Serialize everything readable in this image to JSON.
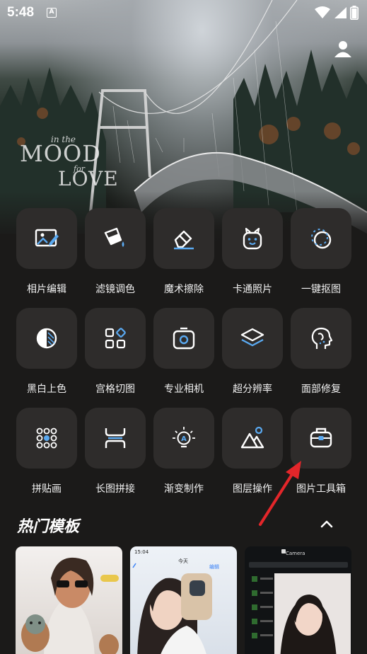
{
  "status_bar": {
    "time": "5:48",
    "notification_glyph": "A"
  },
  "hero": {
    "text_in_the": "in the",
    "text_mood": "MOOD",
    "text_for": "for",
    "text_love": "LOVE"
  },
  "tools": [
    {
      "label": "相片编辑",
      "icon": "photo-edit-icon"
    },
    {
      "label": "滤镜调色",
      "icon": "filter-bucket-icon"
    },
    {
      "label": "魔术擦除",
      "icon": "eraser-icon"
    },
    {
      "label": "卡通照片",
      "icon": "cartoon-face-icon"
    },
    {
      "label": "一键抠图",
      "icon": "cutout-circle-icon"
    },
    {
      "label": "黑白上色",
      "icon": "half-circle-icon"
    },
    {
      "label": "宫格切图",
      "icon": "grid-cut-icon"
    },
    {
      "label": "专业相机",
      "icon": "camera-icon"
    },
    {
      "label": "超分辨率",
      "icon": "layers-icon"
    },
    {
      "label": "面部修复",
      "icon": "face-profile-icon"
    },
    {
      "label": "拼贴画",
      "icon": "dot-grid-icon"
    },
    {
      "label": "长图拼接",
      "icon": "long-stitch-icon"
    },
    {
      "label": "渐变制作",
      "icon": "bulb-a-icon"
    },
    {
      "label": "图层操作",
      "icon": "mountain-layer-icon"
    },
    {
      "label": "图片工具箱",
      "icon": "toolbox-icon"
    }
  ],
  "section": {
    "title": "热门模板"
  },
  "templates": {
    "tpl2_time": "15:04",
    "tpl2_title": "今天",
    "tpl2_edit": "编辑",
    "tpl3_title": "Camera"
  },
  "colors": {
    "accent": "#5aa9f0",
    "tile": "#2e2c2b",
    "background": "#1b1a19",
    "arrow": "#e3262a"
  }
}
